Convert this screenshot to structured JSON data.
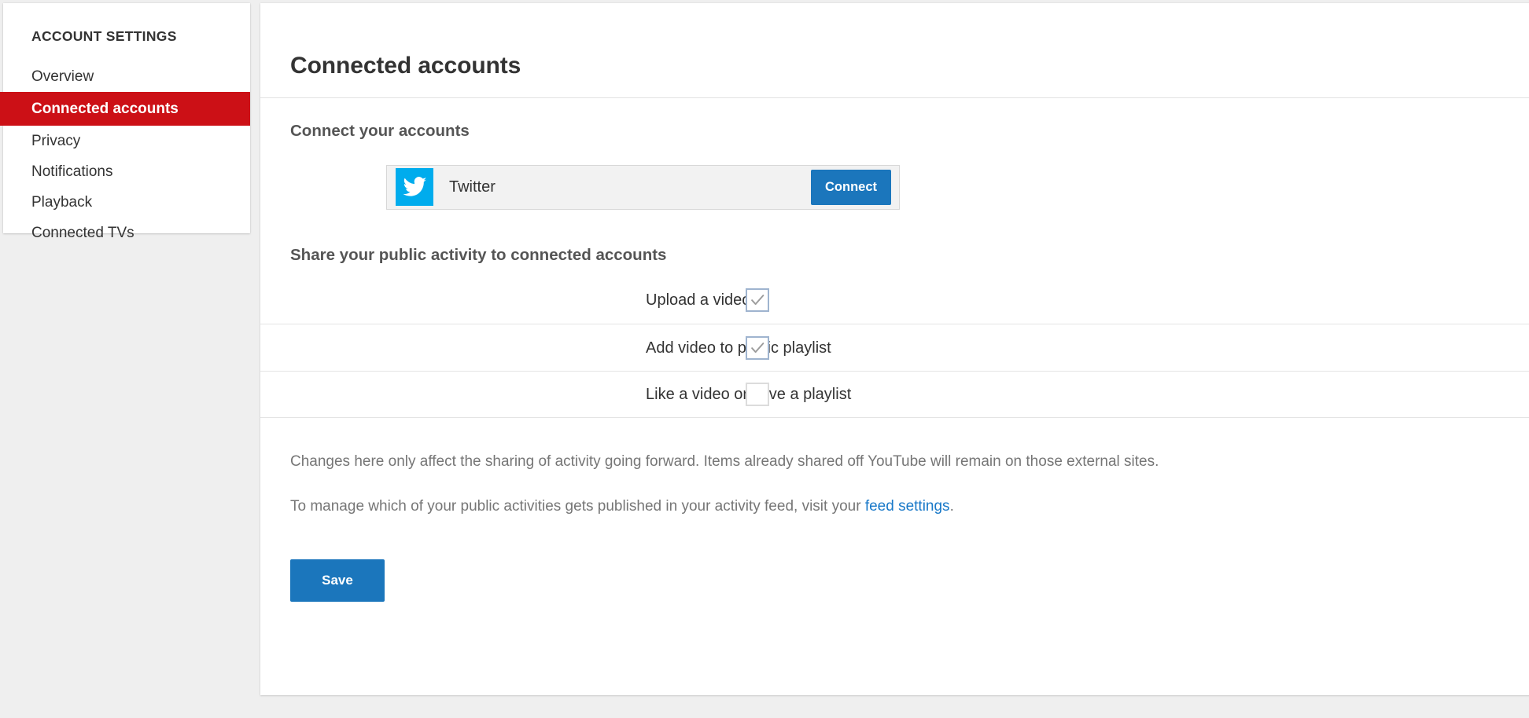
{
  "sidebar": {
    "heading": "ACCOUNT SETTINGS",
    "items": [
      {
        "label": "Overview",
        "active": false
      },
      {
        "label": "Connected accounts",
        "active": true
      },
      {
        "label": "Privacy",
        "active": false
      },
      {
        "label": "Notifications",
        "active": false
      },
      {
        "label": "Playback",
        "active": false
      },
      {
        "label": "Connected TVs",
        "active": false
      }
    ]
  },
  "main": {
    "title": "Connected accounts",
    "connect_section": {
      "heading": "Connect your accounts",
      "provider": {
        "name": "Twitter",
        "icon": "twitter-bird-icon",
        "icon_color": "#00aced",
        "button_label": "Connect"
      }
    },
    "share_section": {
      "heading": "Share your public activity to connected accounts",
      "rows": [
        {
          "label": "Upload a video",
          "checked": true
        },
        {
          "label": "Add video to public playlist",
          "checked": true
        },
        {
          "label": "Like a video or save a playlist",
          "checked": false
        }
      ]
    },
    "notes": {
      "note_1": "Changes here only affect the sharing of activity going forward. Items already shared off YouTube will remain on those external sites.",
      "note_2_prefix": "To manage which of your public activities gets published in your activity feed, visit your ",
      "note_2_link": "feed settings",
      "note_2_suffix": "."
    },
    "save_label": "Save"
  },
  "colors": {
    "accent_red": "#cc1016",
    "accent_blue": "#1b76bc",
    "link_blue": "#1878c8",
    "page_background": "#efefef",
    "checkbox_border_checked": "#9fb4cf",
    "checkbox_border_unchecked": "#dcdcdc",
    "checkmark": "#9b9b9b"
  }
}
